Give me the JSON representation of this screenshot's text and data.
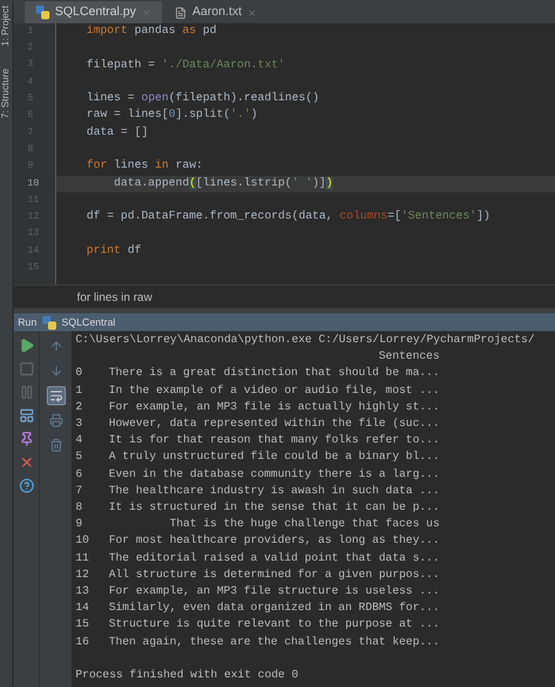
{
  "side_tabs": [
    {
      "label": "1: Project"
    },
    {
      "label": "7: Structure"
    }
  ],
  "tabs": [
    {
      "label": "SQLCentral.py",
      "kind": "python",
      "selected": true
    },
    {
      "label": "Aaron.txt",
      "kind": "text",
      "selected": false
    }
  ],
  "editor": {
    "lines": [
      {
        "number": "1",
        "current": false,
        "tokens": [
          {
            "kind": "keyword",
            "text": "import"
          },
          {
            "kind": "plain",
            "text": " pandas "
          },
          {
            "kind": "keyword",
            "text": "as"
          },
          {
            "kind": "plain",
            "text": " pd"
          }
        ]
      },
      {
        "number": "2",
        "current": false
      },
      {
        "number": "3",
        "current": false,
        "tokens": [
          {
            "kind": "plain",
            "text": "filepath = "
          },
          {
            "kind": "string",
            "text": "'./Data/Aaron.txt'"
          }
        ]
      },
      {
        "number": "4",
        "current": false
      },
      {
        "number": "5",
        "current": false,
        "tokens": [
          {
            "kind": "plain",
            "text": "lines = "
          },
          {
            "kind": "builtin",
            "text": "open"
          },
          {
            "kind": "plain",
            "text": "(filepath).readlines()"
          }
        ]
      },
      {
        "number": "6",
        "current": false,
        "tokens": [
          {
            "kind": "plain",
            "text": "raw = lines["
          },
          {
            "kind": "number",
            "text": "0"
          },
          {
            "kind": "plain",
            "text": "].split("
          },
          {
            "kind": "string",
            "text": "'.'"
          },
          {
            "kind": "plain",
            "text": ")"
          }
        ]
      },
      {
        "number": "7",
        "current": false,
        "tokens": [
          {
            "kind": "plain",
            "text": "data = []"
          }
        ]
      },
      {
        "number": "8",
        "current": false
      },
      {
        "number": "9",
        "current": false,
        "tokens": [
          {
            "kind": "keyword",
            "text": "for"
          },
          {
            "kind": "plain",
            "text": " lines "
          },
          {
            "kind": "keyword",
            "text": "in"
          },
          {
            "kind": "plain",
            "text": " raw:"
          }
        ]
      },
      {
        "number": "10",
        "current": true,
        "tokens": [
          {
            "kind": "plain",
            "text": "    data.append"
          },
          {
            "kind": "match",
            "text": "("
          },
          {
            "kind": "plain",
            "text": "[lines.lstrip("
          },
          {
            "kind": "string",
            "text": "' '"
          },
          {
            "kind": "plain",
            "text": ")]"
          },
          {
            "kind": "match",
            "text": ")"
          }
        ]
      },
      {
        "number": "11",
        "current": false
      },
      {
        "number": "12",
        "current": false,
        "tokens": [
          {
            "kind": "plain",
            "text": "df = pd.DataFrame.from_records(data, "
          },
          {
            "kind": "param",
            "text": "columns"
          },
          {
            "kind": "plain",
            "text": "=["
          },
          {
            "kind": "string",
            "text": "'Sentences'"
          },
          {
            "kind": "plain",
            "text": "])"
          }
        ]
      },
      {
        "number": "13",
        "current": false
      },
      {
        "number": "14",
        "current": false,
        "tokens": [
          {
            "kind": "keyword",
            "text": "print"
          },
          {
            "kind": "plain",
            "text": " df"
          }
        ]
      },
      {
        "number": "15",
        "current": false
      }
    ]
  },
  "breadcrumb": "for lines in raw",
  "run_panel": {
    "label": "Run",
    "config": "SQLCentral",
    "command": "C:\\Users\\Lorrey\\Anaconda\\python.exe C:/Users/Lorrey/PycharmProjects/",
    "column_header": "Sentences",
    "rows": [
      {
        "index": "0",
        "text": "There is a great distinction that should be ma..."
      },
      {
        "index": "1",
        "text": "In the example of a video or audio file, most ..."
      },
      {
        "index": "2",
        "text": "For example, an MP3 file is actually highly st..."
      },
      {
        "index": "3",
        "text": "However, data represented within the file (suc..."
      },
      {
        "index": "4",
        "text": "It is for that reason that many folks refer to..."
      },
      {
        "index": "5",
        "text": "A truly unstructured file could be a binary bl..."
      },
      {
        "index": "6",
        "text": "Even in the database community there is a larg..."
      },
      {
        "index": "7",
        "text": "The healthcare industry is awash in such data ..."
      },
      {
        "index": "8",
        "text": "It is structured in the sense that it can be p..."
      },
      {
        "index": "9",
        "text": "That is the huge challenge that faces us"
      },
      {
        "index": "10",
        "text": "For most healthcare providers, as long as they..."
      },
      {
        "index": "11",
        "text": "The editorial raised a valid point that data s..."
      },
      {
        "index": "12",
        "text": "All structure is determined for a given purpos..."
      },
      {
        "index": "13",
        "text": "For example, an MP3 file structure is useless ..."
      },
      {
        "index": "14",
        "text": "Similarly, even data organized in an RDBMS for..."
      },
      {
        "index": "15",
        "text": "Structure is quite relevant to the purpose at ..."
      },
      {
        "index": "16",
        "text": "Then again, these are the challenges that keep..."
      }
    ],
    "exit_message": "Process finished with exit code 0",
    "tools_left": [
      {
        "kind": "run",
        "disabled": false
      },
      {
        "kind": "stop",
        "disabled": true
      },
      {
        "kind": "pause",
        "disabled": true
      },
      {
        "kind": "layout",
        "disabled": false
      },
      {
        "kind": "pin",
        "disabled": false
      },
      {
        "kind": "close",
        "disabled": false
      },
      {
        "kind": "help",
        "disabled": false
      }
    ],
    "tools_right": [
      {
        "kind": "up",
        "selected": false
      },
      {
        "kind": "down",
        "selected": false
      },
      {
        "kind": "wrap",
        "selected": true
      },
      {
        "kind": "print",
        "selected": false
      },
      {
        "kind": "trash",
        "selected": false
      }
    ]
  }
}
